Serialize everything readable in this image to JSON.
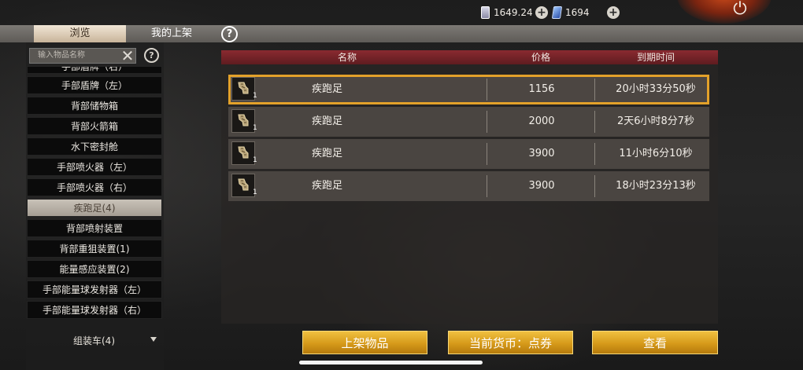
{
  "top_bar": {
    "ticket_amount": "1649.24",
    "crystal_amount": "1694"
  },
  "tabs": [
    {
      "label": "浏览",
      "active": true
    },
    {
      "label": "我的上架",
      "active": false
    }
  ],
  "search": {
    "placeholder": "输入物品名称"
  },
  "categories": [
    {
      "label": "手部盾牌（右）",
      "partial": true
    },
    {
      "label": "手部盾牌（左）"
    },
    {
      "label": "背部储物箱"
    },
    {
      "label": "背部火箭箱"
    },
    {
      "label": "水下密封舱"
    },
    {
      "label": "手部喷火器（左）"
    },
    {
      "label": "手部喷火器（右）"
    },
    {
      "label": "疾跑足(4)",
      "selected": true
    },
    {
      "label": "背部喷射装置"
    },
    {
      "label": "背部重狙装置(1)"
    },
    {
      "label": "能量感应装置(2)"
    },
    {
      "label": "手部能量球发射器（左）"
    },
    {
      "label": "手部能量球发射器（右）"
    }
  ],
  "cart": {
    "label": "组装车(4)"
  },
  "table": {
    "headers": [
      "名称",
      "价格",
      "到期时间"
    ],
    "rows": [
      {
        "qty": "1",
        "name": "疾跑足",
        "price": "1156",
        "expires": "20小时33分50秒",
        "selected": true
      },
      {
        "qty": "1",
        "name": "疾跑足",
        "price": "2000",
        "expires": "2天6小时8分7秒"
      },
      {
        "qty": "1",
        "name": "疾跑足",
        "price": "3900",
        "expires": "11小时6分10秒"
      },
      {
        "qty": "1",
        "name": "疾跑足",
        "price": "3900",
        "expires": "18小时23分13秒"
      }
    ]
  },
  "buttons": {
    "list_item": "上架物品",
    "currency": "当前货币：点券",
    "view": "查看"
  },
  "colors": {
    "accent_gold": "#e3a12a",
    "header_red": "#8a2a30"
  }
}
